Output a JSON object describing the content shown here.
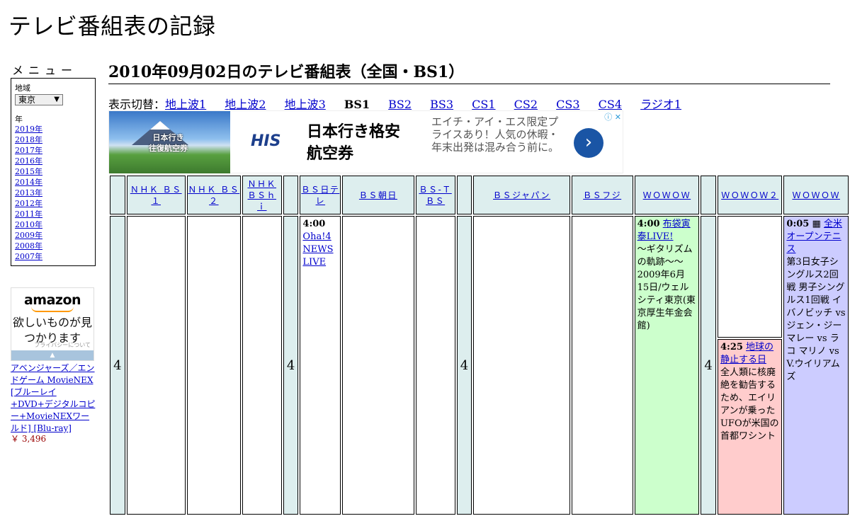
{
  "site_title": "テレビ番組表の記録",
  "menu": {
    "heading": "メニュー",
    "region_label": "地域",
    "region_value": "東京",
    "year_label": "年",
    "years": [
      "2019年",
      "2018年",
      "2017年",
      "2016年",
      "2015年",
      "2014年",
      "2013年",
      "2012年",
      "2011年",
      "2010年",
      "2009年",
      "2008年",
      "2007年"
    ]
  },
  "amazon_ad": {
    "logo": "amazon",
    "tagline": "欲しいものが見つかります",
    "privacy": "プライバシーについて",
    "product_title": "アベンジャーズ／エンドゲーム MovieNEX [ブルーレイ+DVD+デジタルコピー+MovieNEXワールド] [Blu-ray]",
    "product_price": "￥ 3,496"
  },
  "page_heading": "2010年09月02日のテレビ番組表（全国・BS1）",
  "switcher": {
    "label": "表示切替：",
    "items": [
      {
        "label": "地上波1",
        "current": false
      },
      {
        "label": "地上波2",
        "current": false
      },
      {
        "label": "地上波3",
        "current": false
      },
      {
        "label": "BS1",
        "current": true
      },
      {
        "label": "BS2",
        "current": false
      },
      {
        "label": "BS3",
        "current": false
      },
      {
        "label": "CS1",
        "current": false
      },
      {
        "label": "CS2",
        "current": false
      },
      {
        "label": "CS3",
        "current": false
      },
      {
        "label": "CS4",
        "current": false
      },
      {
        "label": "ラジオ1",
        "current": false
      }
    ]
  },
  "his_ad": {
    "photo_text": "日本行き\n往復航空券",
    "logo": "HIS",
    "title": "日本行き格安航空券",
    "body": "エイチ・アイ・エス限定プライスあり！人気の休暇・年末出発は混み合う前に。",
    "next": "›",
    "adchoices": "ⓘ ✕"
  },
  "schedule": {
    "hour": "4",
    "channels": [
      "ＮＨＫ ＢＳ１",
      "ＮＨＫ ＢＳ２",
      "ＮＨＫ ＢＳｈｉ",
      "",
      "ＢＳ日テレ",
      "ＢＳ朝日",
      "ＢＳ-ＴＢＳ",
      "",
      "ＢＳジャパン",
      "ＢＳフジ",
      "ＷＯＷＯＷ",
      "",
      "ＷＯＷＯＷ２",
      "ＷＯＷＯＷ"
    ],
    "programs": {
      "bs_ntv": {
        "time": "4:00",
        "title": "Oha!4 NEWS LIVE"
      },
      "wowow": {
        "time": "4:00",
        "title": "布袋寅泰LIVE!",
        "desc": "～ギタリズムの軌跡～～2009年6月15日/ウェルシティ東京(東京厚生年金会館)"
      },
      "wowow2": {
        "time": "4:25",
        "title": "地球の静止する日",
        "desc": "全人類に核廃絶を勧告するため、エイリアンが乗ったUFOが米国の首都ワシント"
      },
      "wowow3": {
        "time": "0:05",
        "title": "全米オープンテニス",
        "desc": "第3日女子シングルス2回戦 男子シングルス1回戦 イバノビッチ vs ジェン・ジー マレー vs ラコ マリノ vs V.ウイリアムズ"
      }
    }
  }
}
